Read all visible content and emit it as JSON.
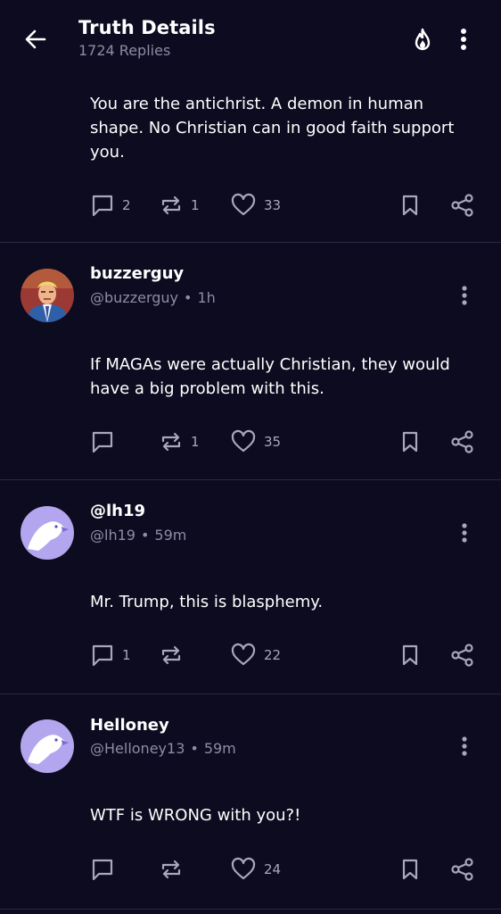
{
  "header": {
    "title": "Truth Details",
    "subtitle": "1724 Replies"
  },
  "posts": [
    {
      "text": "You are the antichrist. A demon in human shape. No Christian can in good faith support you.",
      "reply_count": "2",
      "retruth_count": "1",
      "like_count": "33"
    },
    {
      "display_name": "buzzerguy",
      "handle": "@buzzerguy",
      "time": "1h",
      "text": "If MAGAs were actually Christian, they would have a big problem with this.",
      "reply_count": "",
      "retruth_count": "1",
      "like_count": "35"
    },
    {
      "display_name": "@lh19",
      "handle": "@lh19",
      "time": "59m",
      "text": "Mr. Trump, this is blasphemy.",
      "reply_count": "1",
      "retruth_count": "",
      "like_count": "22"
    },
    {
      "display_name": "Helloney",
      "handle": "@Helloney13",
      "time": "59m",
      "text": "WTF is WRONG with you?!",
      "reply_count": "",
      "retruth_count": "",
      "like_count": "24"
    }
  ],
  "icons": {
    "back": "arrow-left-icon",
    "trending": "flame-icon",
    "more": "more-vertical-icon",
    "reply": "speech-bubble-icon",
    "retruth": "repost-arrows-icon",
    "like": "heart-icon",
    "bookmark": "bookmark-icon",
    "share": "share-icon"
  },
  "colors": {
    "background": "#0d0b1f",
    "text": "#ffffff",
    "muted": "#8e8ca3",
    "icon": "#a9a7bc",
    "divider": "#2b2940",
    "eagle_avatar_bg": "#b3a6ef"
  }
}
